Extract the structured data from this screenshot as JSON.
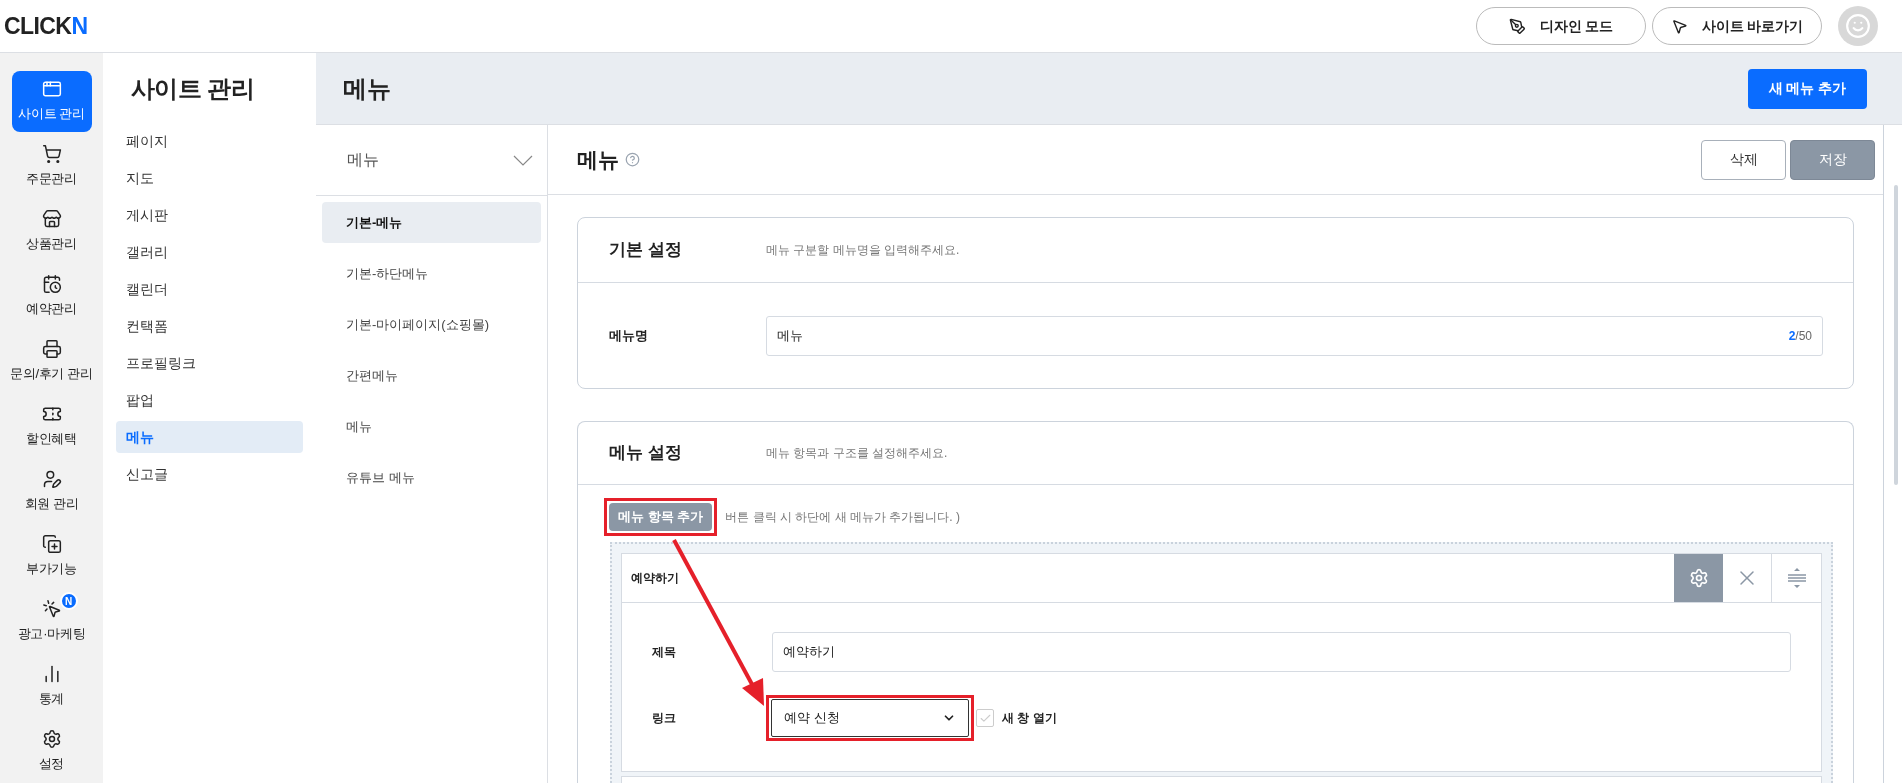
{
  "logo": {
    "text": "CLICK",
    "accent": "N"
  },
  "header_buttons": [
    {
      "label": "디자인 모드",
      "kind": "design"
    },
    {
      "label": "사이트 바로가기",
      "kind": "site"
    }
  ],
  "rail": [
    {
      "label": "사이트 관리",
      "kind": "site",
      "selected": true
    },
    {
      "label": "주문관리",
      "kind": "order",
      "selected": false
    },
    {
      "label": "상품관리",
      "kind": "product",
      "selected": false
    },
    {
      "label": "예약관리",
      "kind": "booking",
      "selected": false
    },
    {
      "label": "문의/후기 관리",
      "kind": "inquiry",
      "selected": false
    },
    {
      "label": "할인혜택",
      "kind": "coupon",
      "selected": false
    },
    {
      "label": "회원 관리",
      "kind": "member",
      "selected": false
    },
    {
      "label": "부가기능",
      "kind": "addon",
      "selected": false
    },
    {
      "label": "광고·마케팅",
      "kind": "marketing",
      "selected": false,
      "badge": "N"
    },
    {
      "label": "통계",
      "kind": "stats",
      "selected": false
    },
    {
      "label": "설정",
      "kind": "settings",
      "selected": false
    }
  ],
  "sidebar": {
    "title": "사이트 관리",
    "items": [
      {
        "label": "페이지",
        "selected": false
      },
      {
        "label": "지도",
        "selected": false
      },
      {
        "label": "게시판",
        "selected": false
      },
      {
        "label": "갤러리",
        "selected": false
      },
      {
        "label": "캘린더",
        "selected": false
      },
      {
        "label": "컨택폼",
        "selected": false
      },
      {
        "label": "프로필링크",
        "selected": false
      },
      {
        "label": "팝업",
        "selected": false
      },
      {
        "label": "메뉴",
        "selected": true
      },
      {
        "label": "신고글",
        "selected": false
      }
    ]
  },
  "page": {
    "title": "메뉴",
    "primary_button": "새 메뉴 추가"
  },
  "menu_list": {
    "dropdown": "메뉴",
    "items": [
      {
        "label": "기본-메뉴",
        "selected": true
      },
      {
        "label": "기본-하단메뉴",
        "selected": false
      },
      {
        "label": "기본-마이페이지(쇼핑몰)",
        "selected": false
      },
      {
        "label": "간편메뉴",
        "selected": false
      },
      {
        "label": "메뉴",
        "selected": false
      },
      {
        "label": "유튜브 메뉴",
        "selected": false
      }
    ]
  },
  "editor": {
    "title": "메뉴",
    "buttons": [
      {
        "label": "삭제",
        "kind": "outline"
      },
      {
        "label": "저장",
        "kind": "filled"
      }
    ],
    "basic": {
      "title": "기본 설정",
      "description": "메뉴 구분할 메뉴명을 입력해주세요.",
      "field_label": "메뉴명",
      "value": "메뉴",
      "count": "2",
      "limit": "/50"
    },
    "menu_settings": {
      "title": "메뉴 설정",
      "description": "메뉴 항목과 구조를 설정해주세요.",
      "add_button": "메뉴 항목 추가",
      "hint": "버튼 클릭 시 하단에 새 메뉴가 추가됩니다. )",
      "item": {
        "name": "예약하기",
        "settings_active": true,
        "title_label": "제목",
        "title_value": "예약하기",
        "link_label": "링크",
        "link_value": "예약 신청",
        "new_window_label": "새 창 열기",
        "new_window": false
      }
    }
  }
}
